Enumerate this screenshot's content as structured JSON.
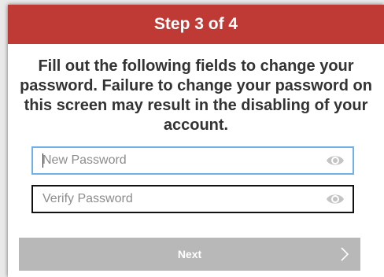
{
  "header": {
    "title": "Step 3 of 4",
    "bg_color": "#bf3a35"
  },
  "instructions": {
    "text": "Fill out the following fields to change your password. Failure to change your password on this screen may result in the disabling of your account."
  },
  "fields": {
    "new_password": {
      "placeholder": "New Password",
      "value": "",
      "icon": "eye-icon",
      "focused": true,
      "border_color": "#6fb0e8"
    },
    "verify_password": {
      "placeholder": "Verify Password",
      "value": "",
      "icon": "eye-icon",
      "border_color": "#111111"
    }
  },
  "next_button": {
    "label": "Next",
    "icon": "chevron-right-icon",
    "bg_color": "#b8b8b8",
    "disabled": true
  }
}
